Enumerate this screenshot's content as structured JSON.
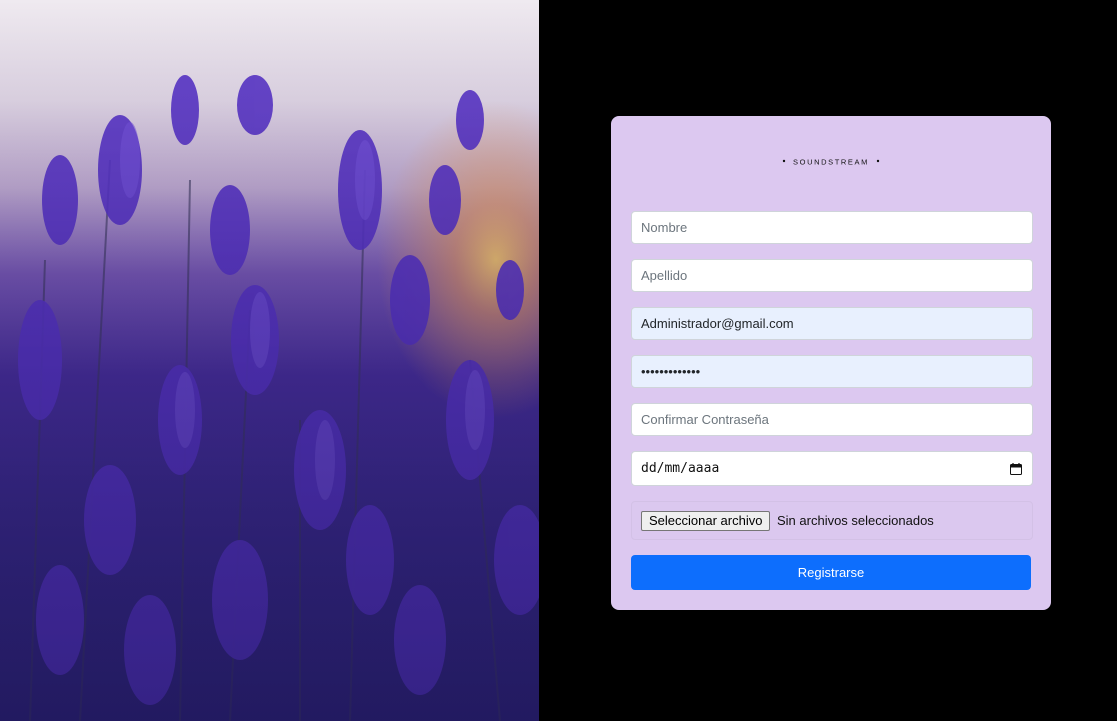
{
  "brand": {
    "logo_text": "SOUNDSTREAM",
    "colors": {
      "accent_magenta": "#b31fa8",
      "accent_purple": "#6a2fd6"
    }
  },
  "background": {
    "description_icon": "lavender-field-photo"
  },
  "form": {
    "nombre": {
      "placeholder": "Nombre",
      "value": ""
    },
    "apellido": {
      "placeholder": "Apellido",
      "value": ""
    },
    "email": {
      "value": "Administrador@gmail.com"
    },
    "password": {
      "value": "•••••••••••••"
    },
    "confirm_password": {
      "placeholder": "Confirmar Contraseña",
      "value": ""
    },
    "birth_date": {
      "placeholder": "dd/mm/aaaa",
      "icon": "calendar-icon"
    },
    "file": {
      "button_label": "Seleccionar archivo",
      "status": "Sin archivos seleccionados"
    },
    "submit_label": "Registrarse"
  },
  "colors": {
    "card_background": "#dcc8f0",
    "button_primary": "#0d6efd",
    "autofill_background": "#e8f0fe",
    "page_background": "#000000"
  }
}
